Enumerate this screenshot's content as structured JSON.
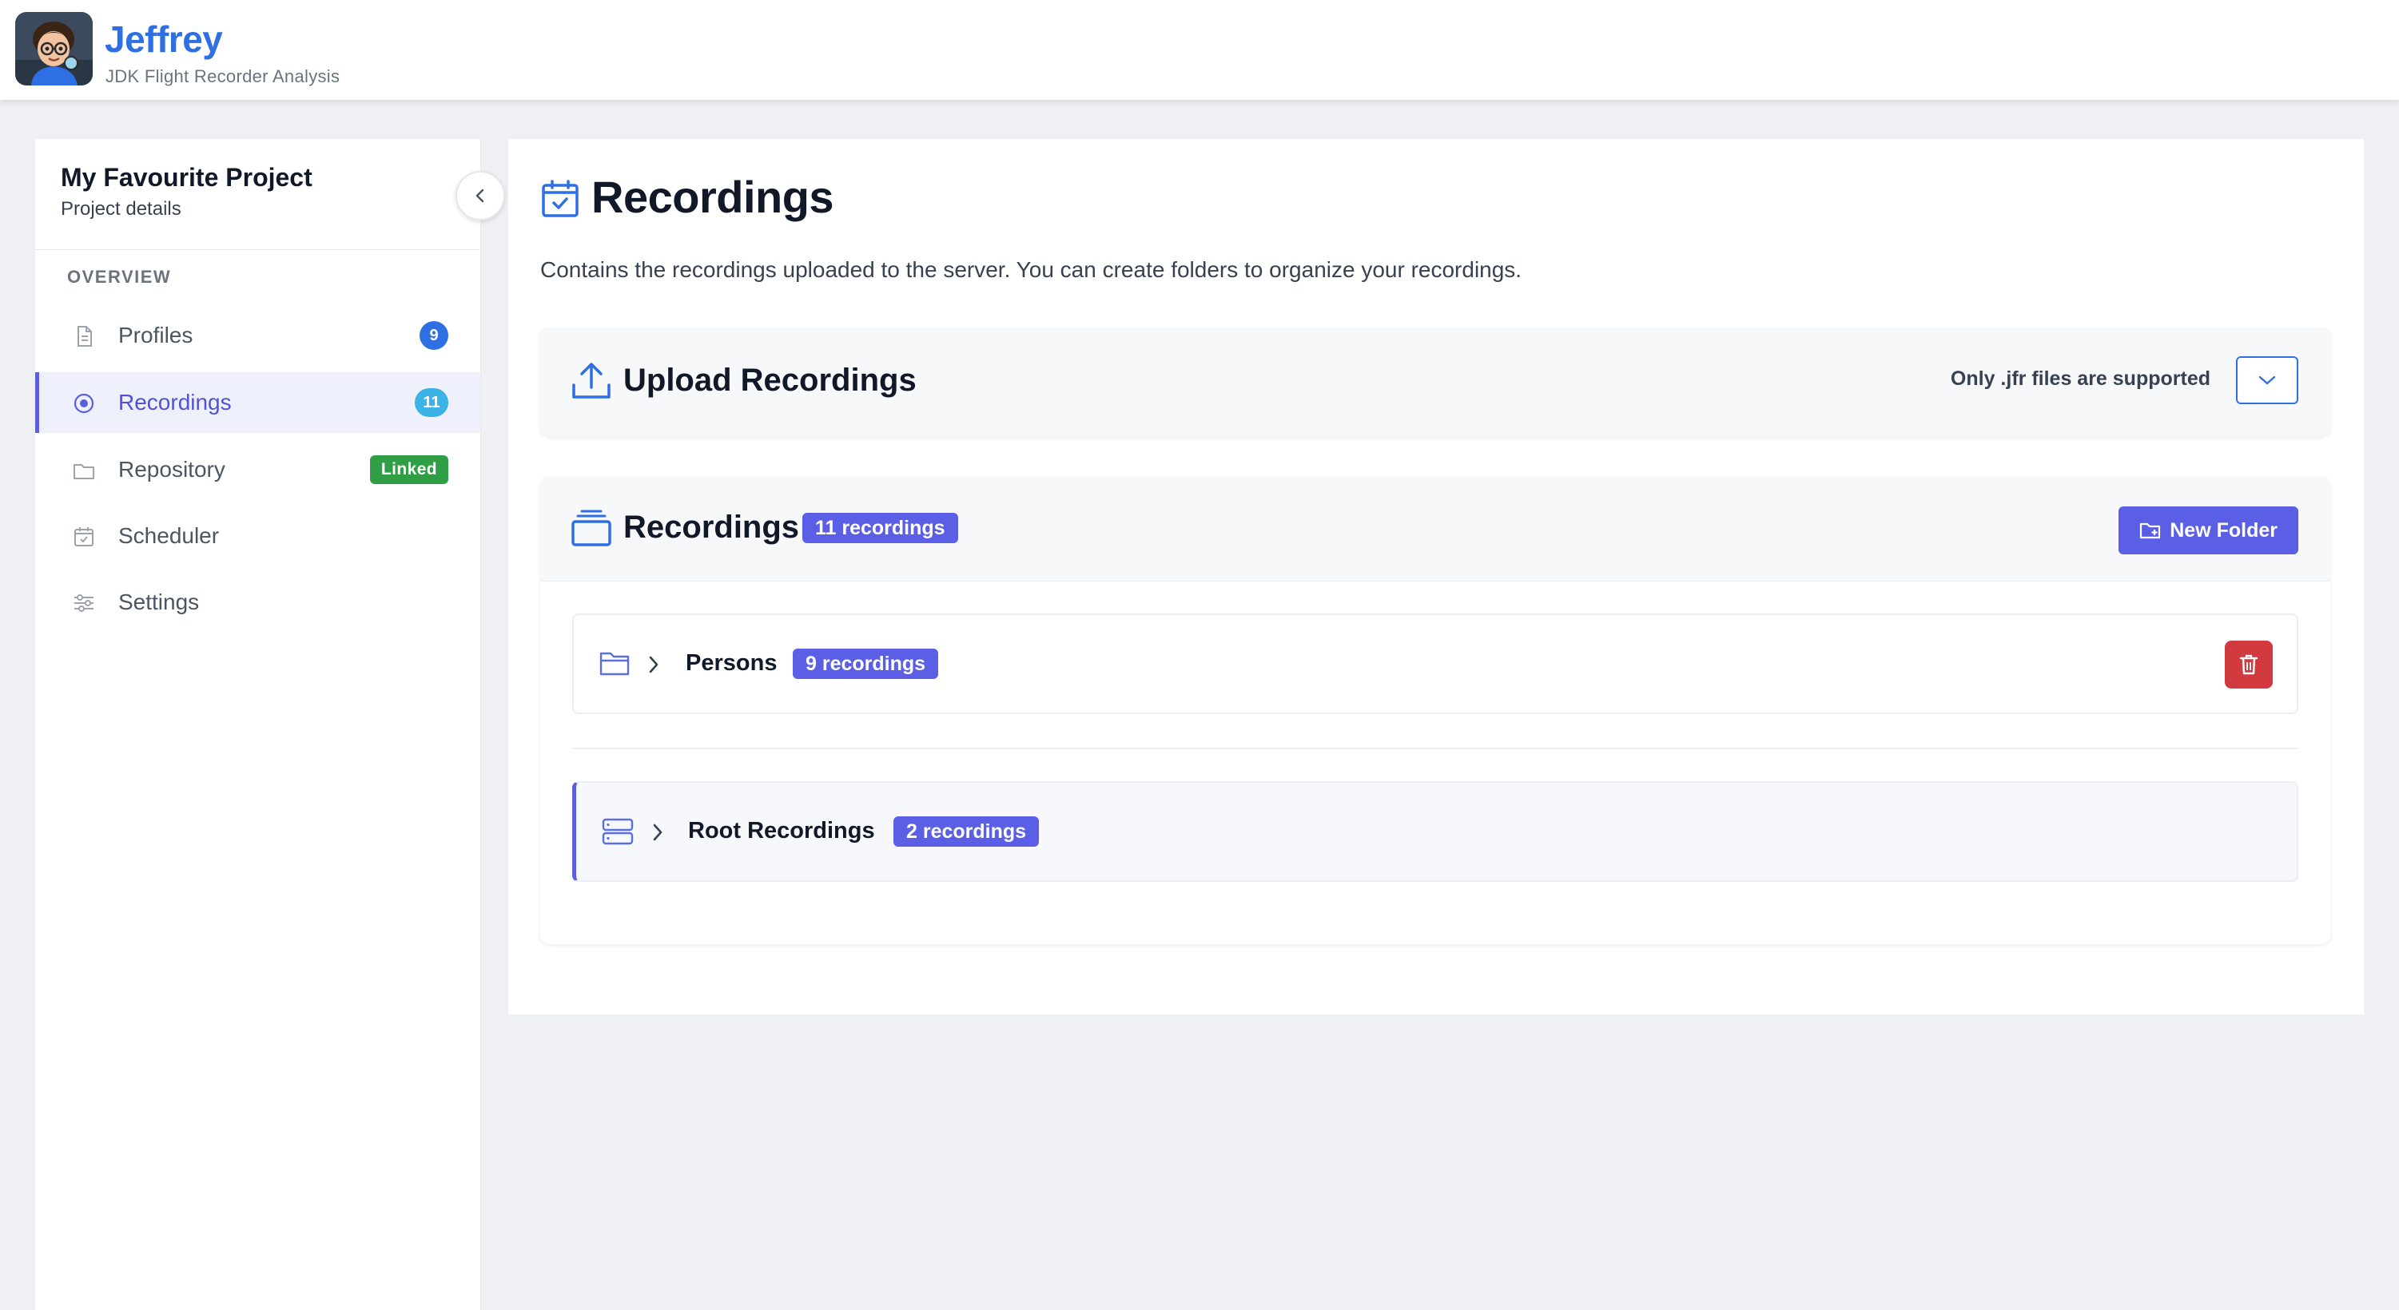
{
  "app": {
    "name": "Jeffrey",
    "subtitle": "JDK Flight Recorder Analysis"
  },
  "sidebar": {
    "project_title": "My Favourite Project",
    "project_subtitle": "Project details",
    "section_label": "OVERVIEW",
    "items": [
      {
        "label": "Profiles",
        "icon": "document-icon",
        "badge": "9",
        "badge_color": "#2f6fe4"
      },
      {
        "label": "Recordings",
        "icon": "record-icon",
        "badge": "11",
        "badge_color": "#3bb3e6",
        "active": true
      },
      {
        "label": "Repository",
        "icon": "folder-icon",
        "badge": "Linked",
        "badge_color": "#2f9e44"
      },
      {
        "label": "Scheduler",
        "icon": "calendar-check-icon"
      },
      {
        "label": "Settings",
        "icon": "sliders-icon"
      }
    ]
  },
  "main": {
    "title": "Recordings",
    "description": "Contains the recordings uploaded to the server. You can create folders to organize your recordings.",
    "upload": {
      "title": "Upload Recordings",
      "note": "Only .jfr files are supported"
    },
    "recordings": {
      "title": "Recordings",
      "count_label": "11 recordings",
      "new_folder_label": "New Folder",
      "folders": [
        {
          "name": "Persons",
          "count_label": "9 recordings"
        },
        {
          "name": "Root Recordings",
          "count_label": "2 recordings"
        }
      ]
    }
  },
  "colors": {
    "brand": "#2f6fe4",
    "accent": "#5b5fe6",
    "danger": "#d13b40",
    "success": "#2f9e44"
  }
}
